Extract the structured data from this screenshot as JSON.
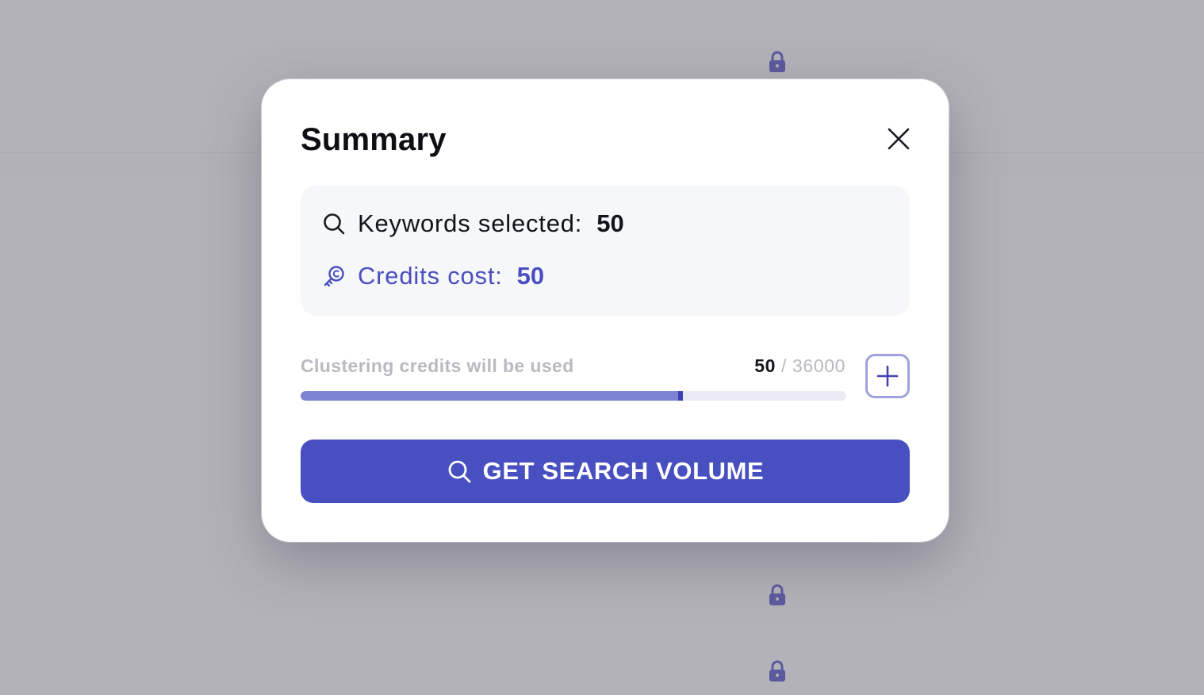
{
  "modal": {
    "title": "Summary",
    "close_icon": "close-icon",
    "summary": {
      "keywords_label": "Keywords selected:",
      "keywords_value": "50",
      "keywords_icon": "search-icon",
      "credits_label": "Credits cost:",
      "credits_value": "50",
      "credits_icon": "credit-key-icon"
    },
    "usage": {
      "label": "Clustering credits will be used",
      "used": "50",
      "separator": " / ",
      "total": "36000",
      "progress_fraction": 0.7,
      "add_icon": "plus-icon"
    },
    "cta": {
      "label": "GET SEARCH VOLUME",
      "icon": "search-icon"
    }
  },
  "background": {
    "lock_icon": "lock-icon"
  },
  "colors": {
    "accent": "#484fc1",
    "accent_text": "#4a4ec0",
    "progress_fill": "#7d82d3",
    "progress_track": "#ecebf4",
    "overlay": "#b2b1b7"
  }
}
